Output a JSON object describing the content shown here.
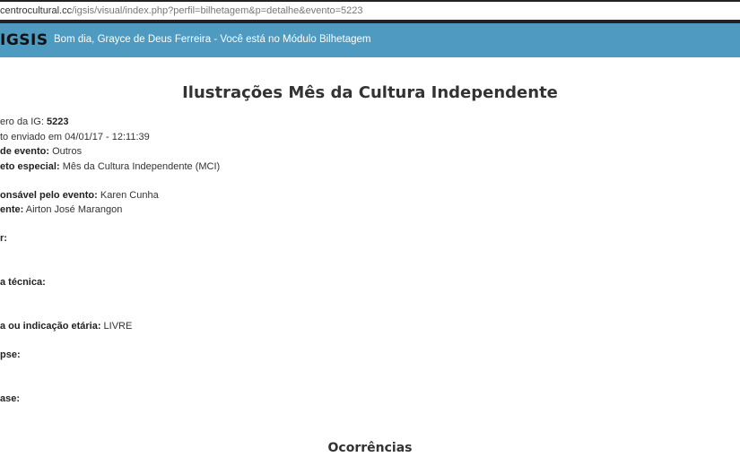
{
  "browser": {
    "url_host": "centrocultural.cc",
    "url_path": "/igsis/visual/index.php?perfil=bilhetagem&p=detalhe&evento=5223"
  },
  "header": {
    "brand": "IGSIS",
    "greeting": "Bom dia, Grayce de Deus Ferreira - Você está no Módulo Bilhetagem"
  },
  "page": {
    "title": "Ilustrações Mês da Cultura Independente",
    "section_title": "Ocorrências"
  },
  "details": [
    {
      "label": "ero da IG:",
      "value": "5223",
      "value_bold": true
    },
    {
      "label": "to enviado em 04/01/17 - 12:11:39",
      "value": "",
      "label_plain": true
    },
    {
      "label": "de evento:",
      "value": "Outros"
    },
    {
      "label": "eto especial:",
      "value": "Mês da Cultura Independente (MCI)"
    },
    {
      "label": "onsável pelo evento:",
      "value": "Karen Cunha"
    },
    {
      "label": "ente:",
      "value": "Airton José Marangon"
    },
    {
      "label": "r:",
      "value": ""
    },
    {
      "label": "a técnica:",
      "value": ""
    },
    {
      "label": "a ou indicação etária:",
      "value": "LIVRE"
    },
    {
      "label": "pse:",
      "value": ""
    },
    {
      "label": "ase:",
      "value": ""
    }
  ]
}
